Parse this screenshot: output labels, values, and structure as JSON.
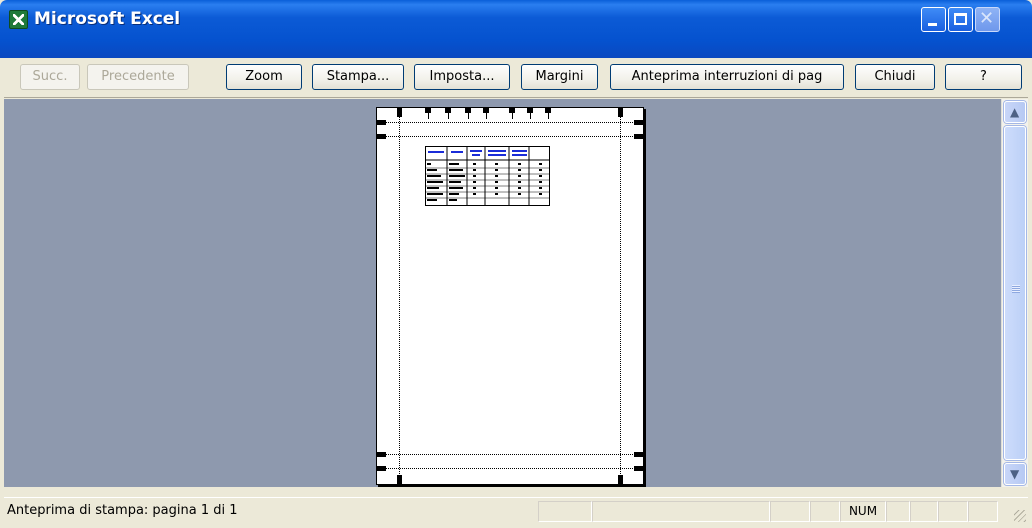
{
  "window": {
    "title": "Microsoft Excel",
    "app_icon": "excel-icon",
    "controls": {
      "minimize": "minimize-icon",
      "maximize": "maximize-icon",
      "close": "✕"
    }
  },
  "toolbar": {
    "buttons": [
      {
        "label": "Succ.",
        "enabled": false
      },
      {
        "label": "Precedente",
        "enabled": false
      },
      {
        "label": "Zoom",
        "enabled": true
      },
      {
        "label": "Stampa...",
        "enabled": true
      },
      {
        "label": "Imposta...",
        "enabled": true
      },
      {
        "label": "Margini",
        "enabled": true
      },
      {
        "label": "Anteprima interruzioni di pag",
        "enabled": true
      },
      {
        "label": "Chiudi",
        "enabled": true
      },
      {
        "label": "?",
        "enabled": true
      }
    ]
  },
  "preview": {
    "background": "#8e99ae",
    "page_count_current": 1,
    "page_count_total": 1
  },
  "scrollbar": {
    "up": "▲",
    "down": "▼"
  },
  "statusbar": {
    "text": "Anteprima di stampa: pagina 1 di 1",
    "num_indicator": "NUM"
  }
}
